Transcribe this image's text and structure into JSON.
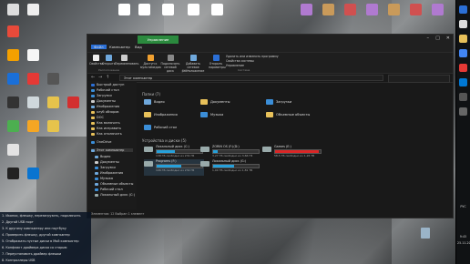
{
  "window": {
    "tabs": [
      "Файл",
      "Компьютер",
      "Вид"
    ],
    "manage_tab": "Управление",
    "ribbon_buttons": [
      "Свойства",
      "Открыть",
      "Переименовать",
      "Доступ к мультимедиа",
      "Подключить сетевой диск",
      "Добавить сетевое расположение",
      "Открыть параметры"
    ],
    "ribbon_right": [
      "Удалить или изменить программу",
      "Свойства системы",
      "Управление"
    ],
    "groups": [
      "Расположение",
      "Сеть",
      "Система"
    ],
    "address": "Этот компьютер",
    "status": "Элементов: 12   Выбран 1 элемент"
  },
  "nav": {
    "items": [
      "Быстрый доступ",
      "Рабочий стол",
      "Загрузки",
      "Документы",
      "Изображения",
      "клуб обзоров",
      "DOC",
      "Как включить",
      "Как исправить",
      "Как отключить",
      "OneDrive",
      "Этот компьютер",
      "Видео",
      "Документы",
      "Загрузки",
      "Изображения",
      "Музыка",
      "Объемные объекты",
      "Рабочий стол",
      "Локальный диск (C:)"
    ]
  },
  "content": {
    "folders_title": "Папки (7)",
    "folders": [
      "Видео",
      "Документы",
      "Загрузки",
      "Изображения",
      "Музыка",
      "Объемные объекты",
      "Рабочий стол"
    ],
    "devices_title": "Устройства и диски (5)",
    "drives": [
      {
        "name": "Локальный диск (C:)",
        "free": "138 ГБ свободно из 231 ГБ",
        "fill": 0.4
      },
      {
        "name": "ZORIN OS (F:)(D:)",
        "free": "3,27 ГБ свободно из 3,66 ГБ",
        "fill": 0.1
      },
      {
        "name": "Games (E:)",
        "free": "58,5 ГБ свободно из 1,26 ТБ",
        "fill": 0.95
      },
      {
        "name": "Programs (F:)",
        "free": "106 ГБ свободно из 232 ГБ",
        "fill": 0.54
      },
      {
        "name": "Локальный диск (G:)",
        "free": "1,00 ТБ свободно из 1,81 ТБ",
        "fill": 0.45
      }
    ]
  },
  "overlay": {
    "lines": [
      "1. Иконки, флешку, перезагрузить, подключить",
      "2. Другой USB порт",
      "3. К другому компьютеру или ноутбуку",
      "4. Проверить флешку, другой компьютер",
      "5. Отображать пустые диски в Мой компьютер",
      "6. Конфликт драйвера диска со старым",
      "7. Переустановить драйвер флешки",
      "8. Контроллеры USB"
    ]
  },
  "taskbar": {
    "time": "9:45",
    "date": "25.11.2021",
    "lang": "РУС"
  }
}
